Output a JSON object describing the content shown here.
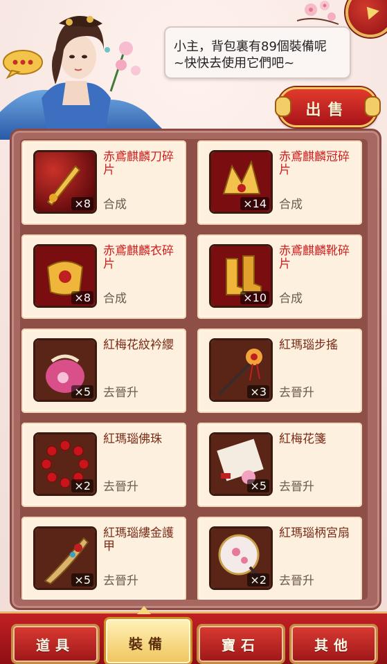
{
  "npc": {
    "speech_line1": "小主，背包裏有89個裝備呢",
    "speech_line2": "~快快去使用它們吧~"
  },
  "sell_button": {
    "label": "出售"
  },
  "items": [
    {
      "name": "赤鳶麒麟刀碎片",
      "qty": "×8",
      "action": "合成",
      "icon": "sword-fragment-icon",
      "rarity": "red"
    },
    {
      "name": "赤鳶麒麟冠碎片",
      "qty": "×14",
      "action": "合成",
      "icon": "crown-fragment-icon",
      "rarity": "red"
    },
    {
      "name": "赤鳶麒麟衣碎片",
      "qty": "×8",
      "action": "合成",
      "icon": "armor-fragment-icon",
      "rarity": "red"
    },
    {
      "name": "赤鳶麒麟靴碎片",
      "qty": "×10",
      "action": "合成",
      "icon": "boots-fragment-icon",
      "rarity": "red"
    },
    {
      "name": "紅梅花紋衿纓",
      "qty": "×5",
      "action": "去晉升",
      "icon": "pouch-icon",
      "rarity": "brown"
    },
    {
      "name": "紅瑪瑙步搖",
      "qty": "×3",
      "action": "去晉升",
      "icon": "hairpin-icon",
      "rarity": "brown"
    },
    {
      "name": "紅瑪瑙佛珠",
      "qty": "×2",
      "action": "去晉升",
      "icon": "prayer-beads-icon",
      "rarity": "brown"
    },
    {
      "name": "紅梅花箋",
      "qty": "×5",
      "action": "去晉升",
      "icon": "letter-icon",
      "rarity": "brown"
    },
    {
      "name": "紅瑪瑙縷金護甲",
      "qty": "×5",
      "action": "去晉升",
      "icon": "nail-guard-icon",
      "rarity": "brown"
    },
    {
      "name": "紅瑪瑙柄宮扇",
      "qty": "×2",
      "action": "去晉升",
      "icon": "palace-fan-icon",
      "rarity": "brown"
    }
  ],
  "tabs": [
    {
      "label": "道具",
      "active": false
    },
    {
      "label": "裝備",
      "active": true
    },
    {
      "label": "寶石",
      "active": false
    },
    {
      "label": "其他",
      "active": false
    }
  ],
  "colors": {
    "fragment_name": "#d11f1f",
    "item_name": "#7a2c18",
    "panel_frame": "#a66860",
    "tab_red": "#c22024",
    "tab_gold": "#f0c45d"
  }
}
